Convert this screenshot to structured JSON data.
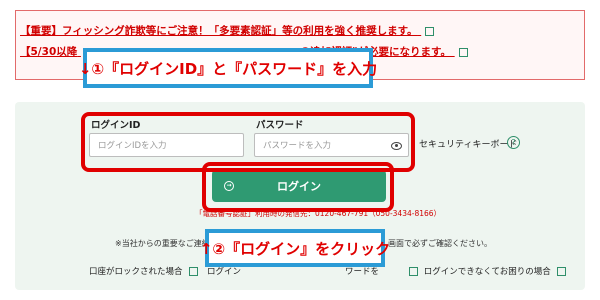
{
  "notice": {
    "line1": "【重要】フィッシング詐欺等にご注意！「多要素認証」等の利用を強く推奨します。",
    "line2_left": "【5/30以降",
    "line2_right": "の追加認証\"が必要になります。"
  },
  "annotations": {
    "step1": "↓①『ログインID』と『パスワード』を入力",
    "step2": "↑②『ログイン』をクリック"
  },
  "login": {
    "id_label": "ログインID",
    "id_placeholder": "ログインIDを入力",
    "password_label": "パスワード",
    "password_placeholder": "パスワードを入力",
    "security_keyboard": "セキュリティキーボード",
    "help_mark": "?",
    "button_label": "ログイン",
    "phone_note": "「電話番号認証」利用時の発信先：0120-467-791（050-3434-8166）"
  },
  "notes": {
    "caution_left": "※当社からの重要なご連絡",
    "caution_right": "画面で必ずご確認ください。"
  },
  "bottom_links": {
    "locked_account": "口座がロックされた場合",
    "forgot_left": "ログイン",
    "forgot_right": "ワードを",
    "cannot_login": "ログインできなくてお困りの場合"
  },
  "colors": {
    "accent": "#2f9a72",
    "warning": "#d10000",
    "annotation_border": "#2b9bd6",
    "highlight": "#e00000",
    "panel": "#eef5f0"
  }
}
